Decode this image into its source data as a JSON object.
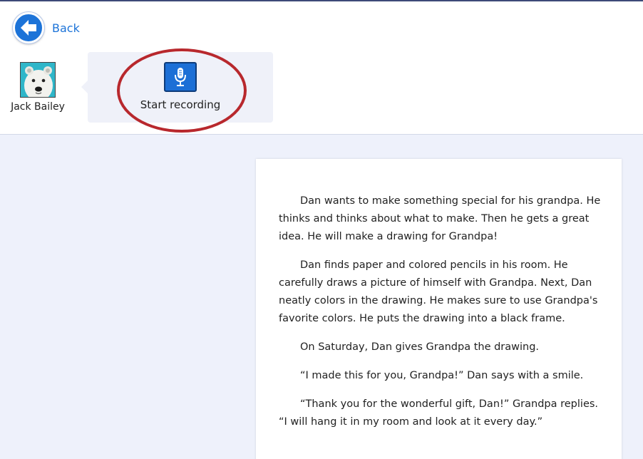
{
  "nav": {
    "back_label": "Back",
    "back_icon": "arrow-left-icon"
  },
  "student": {
    "name": "Jack Bailey",
    "avatar_icon": "polar-bear-avatar"
  },
  "recorder": {
    "label": "Start recording",
    "icon": "microphone-icon",
    "highlight_color": "#b8282d"
  },
  "colors": {
    "accent": "#1c73d8",
    "page_background": "#eef1fb",
    "panel_background": "#eff1f9"
  },
  "story": {
    "paragraphs": [
      "Dan wants to make something special for his grandpa. He thinks and thinks about what to make. Then he gets a great idea. He will make a drawing for Grandpa!",
      "Dan finds paper and colored pencils in his room. He carefully draws a picture of himself with Grandpa. Next, Dan neatly colors in the drawing. He makes sure to use Grandpa's favorite colors. He puts the drawing into a black frame.",
      "On Saturday, Dan gives Grandpa the drawing.",
      "“I made this for you, Grandpa!” Dan says with a smile.",
      "“Thank you for the wonderful gift, Dan!” Grandpa replies. “I will hang it in my room and look at it every day.”"
    ]
  }
}
